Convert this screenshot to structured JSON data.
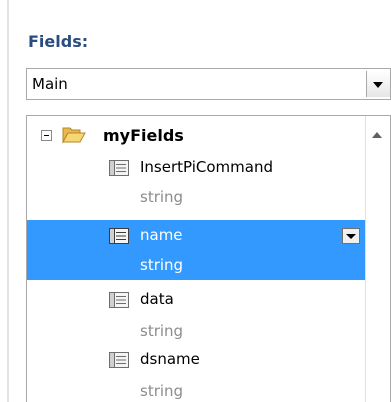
{
  "panel": {
    "title": "Fields:"
  },
  "datasource": {
    "selected": "Main"
  },
  "tree": {
    "root": {
      "label": "myFields",
      "icon": "folder-open-icon"
    },
    "items": [
      {
        "name": "InsertPiCommand",
        "type": "string",
        "icon": "field-icon",
        "selected": false
      },
      {
        "name": "name",
        "type": "string",
        "icon": "field-icon",
        "selected": true
      },
      {
        "name": "data",
        "type": "string",
        "icon": "field-icon",
        "selected": false
      },
      {
        "name": "dsname",
        "type": "string",
        "icon": "field-icon",
        "selected": false
      }
    ]
  },
  "colors": {
    "title": "#2b4c7e",
    "selection": "#3399ff",
    "type_text": "#8c8c8c"
  }
}
